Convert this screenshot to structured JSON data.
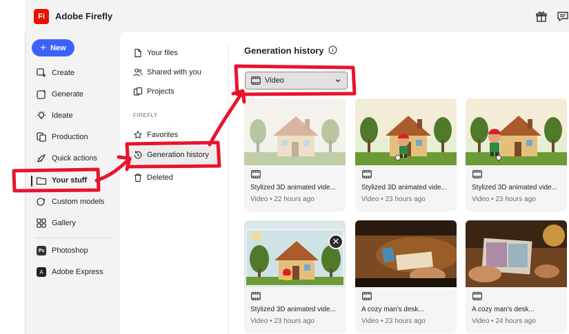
{
  "app": {
    "logo_text": "Fi",
    "name": "Adobe Firefly",
    "brand_color": "#eb1000",
    "accent_color": "#3b63fb"
  },
  "topbar": {
    "icons": [
      "gift-icon",
      "feedback-icon"
    ]
  },
  "sidebar": {
    "new_label": "New",
    "items": [
      {
        "label": "Create",
        "icon": "create-icon"
      },
      {
        "label": "Generate",
        "icon": "generate-icon"
      },
      {
        "label": "Ideate",
        "icon": "ideate-icon"
      },
      {
        "label": "Production",
        "icon": "production-icon"
      },
      {
        "label": "Quick actions",
        "icon": "quick-actions-icon"
      },
      {
        "label": "Your stuff",
        "icon": "folder-icon"
      },
      {
        "label": "Custom models",
        "icon": "custom-models-icon"
      },
      {
        "label": "Gallery",
        "icon": "gallery-icon"
      }
    ],
    "apps": [
      {
        "label": "Photoshop",
        "badge": "Ps"
      },
      {
        "label": "Adobe Express",
        "badge": "A"
      }
    ]
  },
  "subnav": {
    "items": [
      {
        "label": "Your files",
        "icon": "files-icon"
      },
      {
        "label": "Shared with you",
        "icon": "shared-icon"
      },
      {
        "label": "Projects",
        "icon": "projects-icon"
      }
    ],
    "section_heading": "FIREFLY",
    "firefly_items": [
      {
        "label": "Favorites",
        "icon": "star-icon"
      },
      {
        "label": "Generation history",
        "icon": "history-icon"
      },
      {
        "label": "Deleted",
        "icon": "trash-icon"
      }
    ]
  },
  "main": {
    "title": "Generation history",
    "filter_value": "Video",
    "cards": [
      {
        "title": "Stylized 3D animated vide...",
        "meta": "Video • 22 hours ago"
      },
      {
        "title": "Stylized 3D animated vide...",
        "meta": "Video • 23 hours ago"
      },
      {
        "title": "Stylized 3D animated vide...",
        "meta": "Video • 23 hours ago"
      },
      {
        "title": "Stylized 3D animated vide...",
        "meta": "Video • 23 hours ago"
      },
      {
        "title": "A cozy man's desk...",
        "meta": "Video • 23 hours ago"
      },
      {
        "title": "A cozy man's desk...",
        "meta": "Video • 24 hours ago"
      }
    ]
  },
  "annotation_color": "#e8142c"
}
